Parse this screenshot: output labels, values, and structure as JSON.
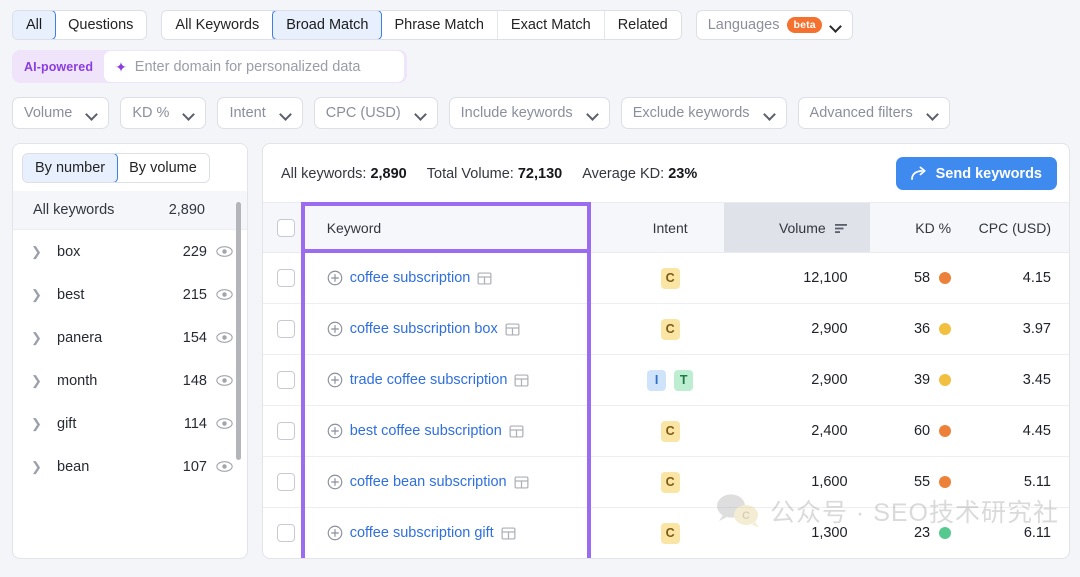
{
  "match_tabs": {
    "group1": [
      {
        "label": "All",
        "active": true
      },
      {
        "label": "Questions",
        "active": false
      }
    ],
    "group2": [
      {
        "label": "All Keywords",
        "active": false
      },
      {
        "label": "Broad Match",
        "active": true
      },
      {
        "label": "Phrase Match",
        "active": false
      },
      {
        "label": "Exact Match",
        "active": false
      },
      {
        "label": "Related",
        "active": false
      }
    ],
    "languages": {
      "label": "Languages",
      "badge": "beta",
      "icon": "chevron-down-icon"
    }
  },
  "ai_bar": {
    "badge": "AI-powered",
    "icon": "sparkle-icon",
    "placeholder": "Enter domain for personalized data",
    "value": "",
    "accent": "#8b3ee0"
  },
  "filters": [
    {
      "label": "Volume"
    },
    {
      "label": "KD %"
    },
    {
      "label": "Intent"
    },
    {
      "label": "CPC (USD)"
    },
    {
      "label": "Include keywords"
    },
    {
      "label": "Exclude keywords"
    },
    {
      "label": "Advanced filters"
    }
  ],
  "sidebar": {
    "toggle": [
      {
        "label": "By number",
        "active": true
      },
      {
        "label": "By volume",
        "active": false
      }
    ],
    "all_row": {
      "label": "All keywords",
      "count": "2,890"
    },
    "items": [
      {
        "label": "box",
        "count": "229",
        "icon": "eye-icon",
        "caret": "chevron-right-icon"
      },
      {
        "label": "best",
        "count": "215",
        "icon": "eye-icon",
        "caret": "chevron-right-icon"
      },
      {
        "label": "panera",
        "count": "154",
        "icon": "eye-icon",
        "caret": "chevron-right-icon"
      },
      {
        "label": "month",
        "count": "148",
        "icon": "eye-icon",
        "caret": "chevron-right-icon"
      },
      {
        "label": "gift",
        "count": "114",
        "icon": "eye-icon",
        "caret": "chevron-right-icon"
      },
      {
        "label": "bean",
        "count": "107",
        "icon": "eye-icon",
        "caret": "chevron-right-icon"
      }
    ]
  },
  "main": {
    "stats": {
      "keywords_label": "All keywords:",
      "keywords_value": "2,890",
      "volume_label": "Total Volume:",
      "volume_value": "72,130",
      "kd_label": "Average KD:",
      "kd_value": "23%"
    },
    "send_button": {
      "label": "Send keywords",
      "icon": "share-arrow-icon",
      "color": "#3f8aef"
    },
    "columns": [
      {
        "key": "checkbox",
        "label": ""
      },
      {
        "key": "keyword",
        "label": "Keyword"
      },
      {
        "key": "intent",
        "label": "Intent"
      },
      {
        "key": "volume",
        "label": "Volume",
        "sorted": true,
        "sort_icon": "sort-descending-icon"
      },
      {
        "key": "kd",
        "label": "KD %"
      },
      {
        "key": "cpc",
        "label": "CPC (USD)"
      }
    ],
    "rows": [
      {
        "keyword": "coffee subscription",
        "intent": [
          "C"
        ],
        "volume": "12,100",
        "kd": "58",
        "kd_color": "#ec8239",
        "cpc": "4.15"
      },
      {
        "keyword": "coffee subscription box",
        "intent": [
          "C"
        ],
        "volume": "2,900",
        "kd": "36",
        "kd_color": "#f2c040",
        "cpc": "3.97"
      },
      {
        "keyword": "trade coffee subscription",
        "intent": [
          "I",
          "T"
        ],
        "volume": "2,900",
        "kd": "39",
        "kd_color": "#f2c040",
        "cpc": "3.45"
      },
      {
        "keyword": "best coffee subscription",
        "intent": [
          "C"
        ],
        "volume": "2,400",
        "kd": "60",
        "kd_color": "#ec8239",
        "cpc": "4.45"
      },
      {
        "keyword": "coffee bean subscription",
        "intent": [
          "C"
        ],
        "volume": "1,600",
        "kd": "55",
        "kd_color": "#ec8239",
        "cpc": "5.11"
      },
      {
        "keyword": "coffee subscription gift",
        "intent": [
          "C"
        ],
        "volume": "1,300",
        "kd": "23",
        "kd_color": "#55c98e",
        "cpc": "6.11"
      }
    ],
    "highlight_color": "#9b6cf0"
  },
  "watermark": {
    "text": "公众号 · SEO技术研究社",
    "icon": "wechat-icon"
  }
}
